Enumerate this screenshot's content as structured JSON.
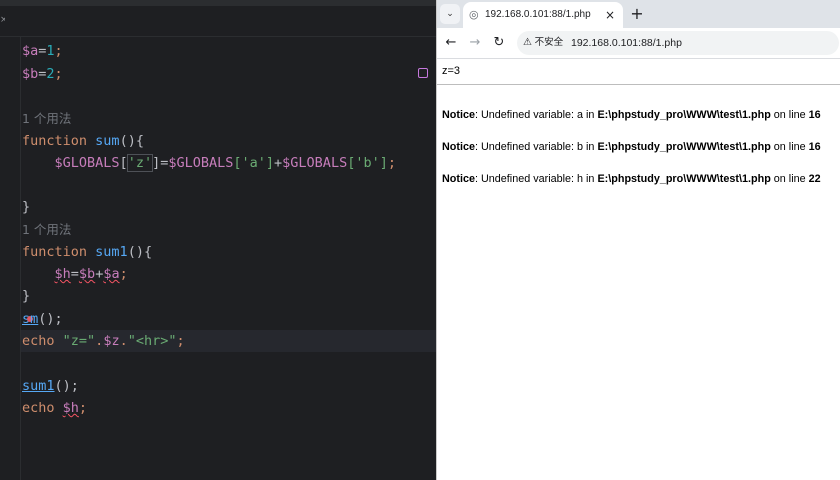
{
  "ide": {
    "tab_close": "×",
    "lines": {
      "l1_var": "$a",
      "l1_eq": "=",
      "l1_num": "1",
      "l1_semi": ";",
      "l2_var": "$b",
      "l2_eq": "=",
      "l2_num": "2",
      "l2_semi": ";",
      "usage_1": "1 个用法",
      "l4_kw": "function",
      "l4_fn": "sum",
      "l4_rest": "(){",
      "l5_g1": "$GLOBALS",
      "l5_b1": "[",
      "l5_s1": "'z'",
      "l5_b1c": "]",
      "l5_eq": "=",
      "l5_g2": "$GLOBALS",
      "l5_s2": "['a']",
      "l5_plus": "+",
      "l5_g3": "$GLOBALS",
      "l5_s3": "['b']",
      "l5_semi": ";",
      "l7": "}",
      "usage_2": "1 个用法",
      "l9_kw": "function",
      "l9_fn": "sum1",
      "l9_rest": "(){",
      "l10_v1": "$h",
      "l10_eq": "=",
      "l10_v2": "$b",
      "l10_plus": "+",
      "l10_v3": "$a",
      "l10_semi": ";",
      "l11": "}",
      "l12_fn_a": "s",
      "l12_fn_b": "m",
      "l12_rest": "();",
      "l13_kw": "echo",
      "l13_s1": "\"z=\"",
      "l13_dot1": ".",
      "l13_var": "$z",
      "l13_dot2": ".",
      "l13_s2": "\"<hr>\"",
      "l13_semi": ";",
      "l15_fn": "sum1",
      "l15_rest": "();",
      "l16_kw": "echo",
      "l16_var": "$h",
      "l16_semi": ";"
    }
  },
  "browser": {
    "dropdown_icon": "⌄",
    "tab": {
      "title": "192.168.0.101:88/1.php",
      "close": "×",
      "globe": "◎"
    },
    "new_tab": "+",
    "nav": {
      "back": "←",
      "forward": "→",
      "reload": "↻"
    },
    "security_icon": "⚠",
    "security_label": "不安全",
    "url": "192.168.0.101:88/1.php",
    "output": {
      "z_line": "z=3",
      "notices": [
        {
          "label": "Notice",
          "message": ": Undefined variable: a in ",
          "path": "E:\\phpstudy_pro\\WWW\\test\\1.php",
          "on_line": " on line ",
          "line": "16"
        },
        {
          "label": "Notice",
          "message": ": Undefined variable: b in ",
          "path": "E:\\phpstudy_pro\\WWW\\test\\1.php",
          "on_line": " on line ",
          "line": "16"
        },
        {
          "label": "Notice",
          "message": ": Undefined variable: h in ",
          "path": "E:\\phpstudy_pro\\WWW\\test\\1.php",
          "on_line": " on line ",
          "line": "22"
        }
      ]
    }
  }
}
